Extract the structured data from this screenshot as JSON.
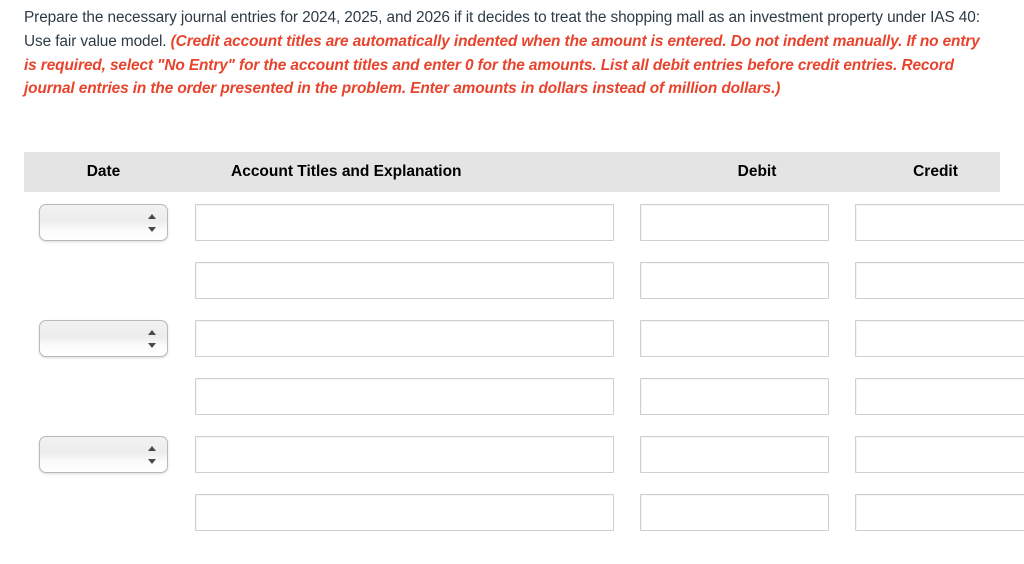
{
  "instructions": {
    "plain_text": "Prepare the necessary journal entries for 2024, 2025, and 2026 if it decides to treat the shopping mall as an investment property under IAS 40: Use fair value model. ",
    "note_text": "(Credit account titles are automatically indented when the amount is entered. Do not indent manually. If no entry is required, select \"No Entry\" for the account titles and enter 0 for the amounts. List all debit entries before credit entries. Record journal entries in the order presented in the problem. Enter amounts in dollars instead of million dollars.)",
    "note_color": "#e8432c",
    "text_color": "#2d3b45"
  },
  "table": {
    "header_background": "#e4e4e4",
    "columns": [
      {
        "key": "date",
        "label": "Date"
      },
      {
        "key": "account",
        "label": "Account Titles and Explanation"
      },
      {
        "key": "debit",
        "label": "Debit"
      },
      {
        "key": "credit",
        "label": "Credit"
      }
    ],
    "date_select_placeholder": "",
    "date_options": [
      ""
    ],
    "rows": [
      {
        "has_date": true,
        "date_value": "",
        "account_value": "",
        "debit_value": "",
        "credit_value": ""
      },
      {
        "has_date": false,
        "date_value": "",
        "account_value": "",
        "debit_value": "",
        "credit_value": ""
      },
      {
        "has_date": true,
        "date_value": "",
        "account_value": "",
        "debit_value": "",
        "credit_value": ""
      },
      {
        "has_date": false,
        "date_value": "",
        "account_value": "",
        "debit_value": "",
        "credit_value": ""
      },
      {
        "has_date": true,
        "date_value": "",
        "account_value": "",
        "debit_value": "",
        "credit_value": ""
      },
      {
        "has_date": false,
        "date_value": "",
        "account_value": "",
        "debit_value": "",
        "credit_value": ""
      }
    ]
  }
}
